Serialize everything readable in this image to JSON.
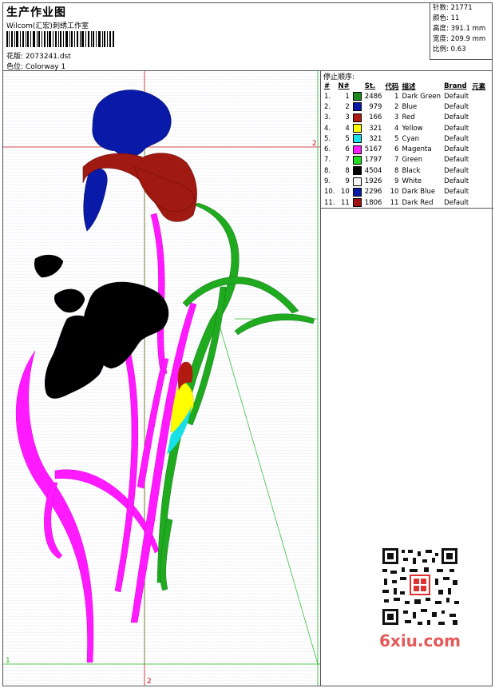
{
  "header": {
    "title": "生产作业图",
    "studio": "Wilcom(汇宏)刺绣工作室",
    "design_label": "花版:",
    "design_value": "2073241.dst",
    "colorway_label": "色位:",
    "colorway_value": "Colorway 1"
  },
  "stats": {
    "stitches_label": "针数:",
    "stitches_value": "21771",
    "colors_label": "颜色:",
    "colors_value": "11",
    "height_label": "高度:",
    "height_value": "391.1 mm",
    "width_label": "宽度:",
    "width_value": "209.9 mm",
    "scale_label": "比例:",
    "scale_value": "0.63"
  },
  "stop_sequence": {
    "title": "停止顺序:",
    "headers": {
      "hash": "#",
      "no": "N#",
      "st": "St.",
      "code": "代码",
      "desc": "描述",
      "brand": "Brand",
      "elem": "元素"
    },
    "rows": [
      {
        "hash": "1.",
        "no": "1",
        "color": "#1b8a1b",
        "st": "2486",
        "code": "1",
        "desc": "Dark Green",
        "brand": "Default"
      },
      {
        "hash": "2.",
        "no": "2",
        "color": "#0a1aa8",
        "st": "979",
        "code": "2",
        "desc": "Blue",
        "brand": "Default"
      },
      {
        "hash": "3.",
        "no": "3",
        "color": "#b01a10",
        "st": "166",
        "code": "3",
        "desc": "Red",
        "brand": "Default"
      },
      {
        "hash": "4.",
        "no": "4",
        "color": "#ffff00",
        "st": "321",
        "code": "4",
        "desc": "Yellow",
        "brand": "Default"
      },
      {
        "hash": "5.",
        "no": "5",
        "color": "#19e0e6",
        "st": "321",
        "code": "5",
        "desc": "Cyan",
        "brand": "Default"
      },
      {
        "hash": "6.",
        "no": "6",
        "color": "#ff1aff",
        "st": "5167",
        "code": "6",
        "desc": "Magenta",
        "brand": "Default"
      },
      {
        "hash": "7.",
        "no": "7",
        "color": "#22dd22",
        "st": "1797",
        "code": "7",
        "desc": "Green",
        "brand": "Default"
      },
      {
        "hash": "8.",
        "no": "8",
        "color": "#000000",
        "st": "4504",
        "code": "8",
        "desc": "Black",
        "brand": "Default"
      },
      {
        "hash": "9.",
        "no": "9",
        "color": "#f4f4f4",
        "st": "1926",
        "code": "9",
        "desc": "White",
        "brand": "Default"
      },
      {
        "hash": "10.",
        "no": "10",
        "color": "#0a1aa8",
        "st": "2296",
        "code": "10",
        "desc": "Dark Blue",
        "brand": "Default"
      },
      {
        "hash": "11.",
        "no": "11",
        "color": "#a01010",
        "st": "1806",
        "code": "11",
        "desc": "Dark Red",
        "brand": "Default"
      }
    ]
  },
  "canvas": {
    "marker_top_right": "2",
    "marker_bottom_left": "1",
    "marker_bottom_center": "2"
  },
  "watermark": "6xiu.com"
}
